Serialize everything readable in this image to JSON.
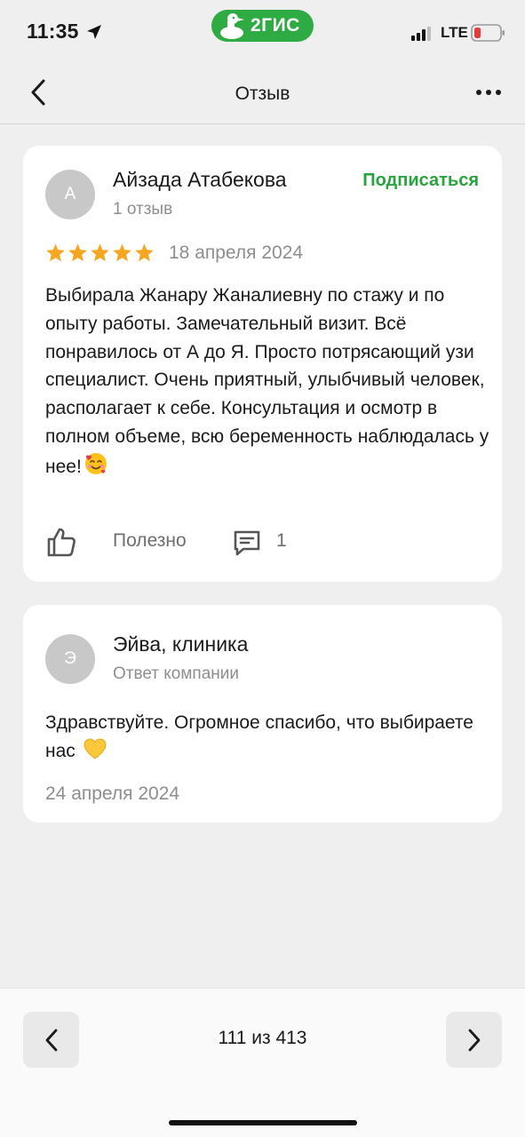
{
  "status_bar": {
    "time": "11:35",
    "brand": "2ГИС",
    "network": "LTE",
    "icons": [
      "location-arrow-icon",
      "signal-icon",
      "battery-low-icon"
    ]
  },
  "nav": {
    "title": "Отзыв",
    "icons": [
      "chevron-left-icon",
      "more-icon"
    ]
  },
  "review": {
    "avatar_letter": "А",
    "author": "Айзада Атабекова",
    "author_sub": "1 отзыв",
    "subscribe_label": "Подписаться",
    "rating": 5,
    "date": "18 апреля 2024",
    "text": "Выбирала Жанару Жаналиевну по стажу и по опыту работы. Замечательный визит. Всё понравилось от А до Я. Просто потрясающий узи специалист. Очень приятный, улыбчивый человек, располагает к себе. Консультация и осмотр в полном объеме, всю беременность наблюдалась у нее!",
    "emoji": "smiling-face-with-hearts",
    "helpful_label": "Полезно",
    "comments_count": "1"
  },
  "reply": {
    "avatar_letter": "Э",
    "author": "Эйва, клиника",
    "author_sub": "Ответ компании",
    "text": "Здравствуйте. Огромное спасибо, что выбираете нас",
    "emoji": "yellow-heart",
    "date": "24 апреля 2024"
  },
  "pager": {
    "label": "111 из 413"
  },
  "colors": {
    "accent": "#28a43e",
    "brand_pill": "#2fab43",
    "star": "#f5a623",
    "background": "#efefef",
    "card": "#ffffff",
    "muted_text": "#8e8e8e"
  }
}
